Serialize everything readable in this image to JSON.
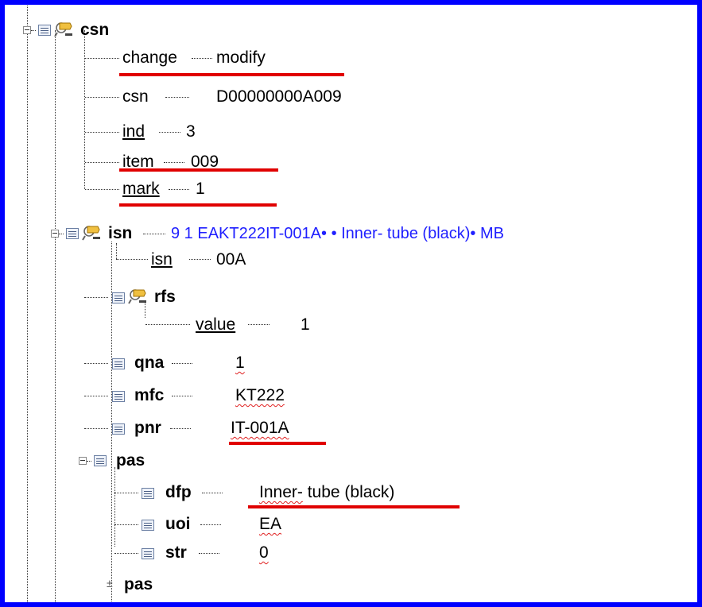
{
  "tree": {
    "csn_node": {
      "tag": "csn"
    },
    "attrs": [
      {
        "name": "change",
        "value": "modify"
      },
      {
        "name": "csn",
        "value": "D00000000A009"
      },
      {
        "name": "ind",
        "value": "3"
      },
      {
        "name": "item",
        "value": "009"
      },
      {
        "name": "mark",
        "value": "1"
      }
    ],
    "isn_node": {
      "tag": "isn",
      "summary": "9 1 EAKT222IT-001A• •  Inner- tube (black)• MB"
    },
    "isn_attr": {
      "name": "isn",
      "value": "00A"
    },
    "rfs_node": {
      "tag": "rfs"
    },
    "rfs_attr": {
      "name": "value",
      "value": "1"
    },
    "leaves": [
      {
        "tag": "qna",
        "value": "1"
      },
      {
        "tag": "mfc",
        "value": "KT222"
      },
      {
        "tag": "pnr",
        "value": "IT-001A"
      }
    ],
    "pas_node": {
      "tag": "pas"
    },
    "pas_children": [
      {
        "tag": "dfp",
        "value": "Inner- tube (black)",
        "value_part1": "Inner-",
        "value_part2": " tube (black)"
      },
      {
        "tag": "uoi",
        "value": "EA"
      },
      {
        "tag": "str",
        "value": "0"
      }
    ],
    "pas_collapsed": {
      "tag": "pas"
    }
  },
  "icons": [
    "element-icon",
    "attribute-search-icon",
    "expand-icon",
    "collapse-icon"
  ],
  "colors": {
    "frame_border": "#0000ff",
    "highlight_underline": "#e00000",
    "summary_text": "#2020ff"
  }
}
